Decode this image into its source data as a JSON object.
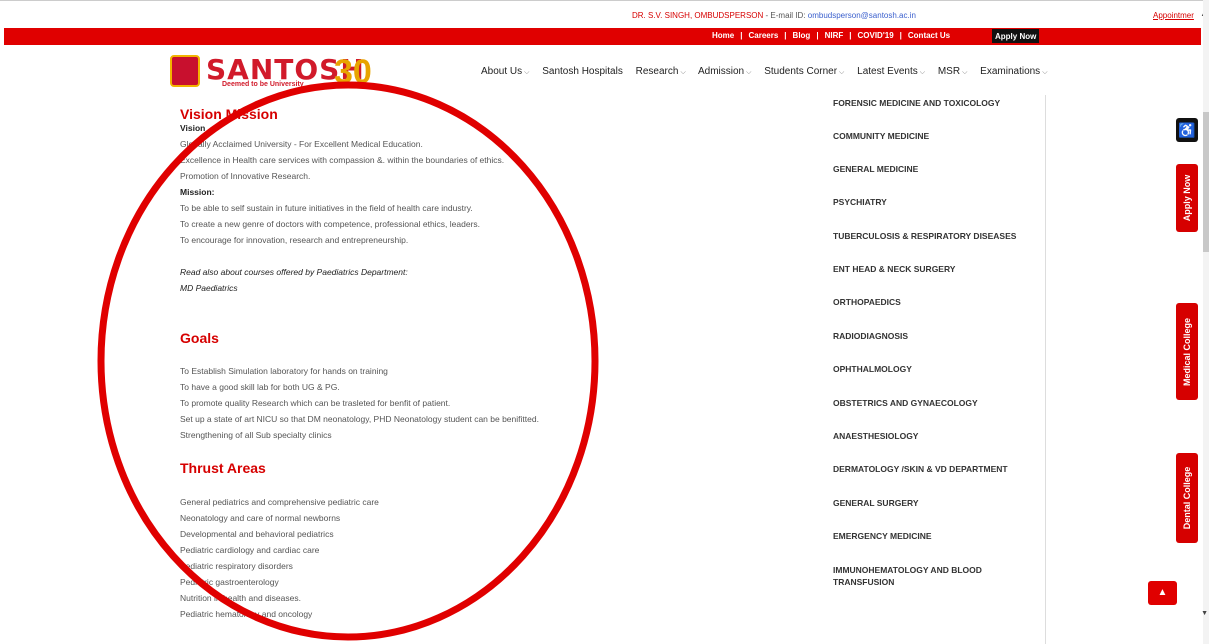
{
  "topbar": {
    "ombud_name": "DR. S.V. SINGH, OMBUDSPERSON",
    "email_label": " - E-mail ID: ",
    "email": "ombudsperson@santosh.ac.in",
    "appointment": "Appointmer",
    "scroll_up": "▲"
  },
  "redbar": {
    "links": [
      "Home",
      "Careers",
      "Blog",
      "NIRF",
      "COVID'19",
      "Contact Us"
    ],
    "apply_now": "Apply Now"
  },
  "header": {
    "logo_text": "SANTOSH",
    "logo_sub": "Deemed to be University",
    "logo_30": "30",
    "nav": [
      "About Us",
      "Santosh Hospitals",
      "Research",
      "Admission",
      "Students Corner",
      "Latest Events",
      "MSR",
      "Examinations"
    ]
  },
  "content": {
    "vision_mission_heading": "Vision Mission",
    "vision_label": "Vision",
    "vision_lines": [
      "Globally Acclaimed University - For Excellent Medical Education.",
      "Excellence in Health care services with compassion &. within the boundaries of ethics.",
      "Promotion of Innovative Research."
    ],
    "mission_label": "Mission:",
    "mission_lines": [
      "To be able to self sustain in future initiatives in the field of health care industry.",
      "To create a new genre of doctors with competence, professional ethics, leaders.",
      "To encourage for innovation, research and entrepreneurship."
    ],
    "read_also": "Read also about courses offered by Paediatrics Department:",
    "md_link": "MD Paediatrics",
    "goals_heading": "Goals",
    "goals_lines": [
      "To Establish Simulation laboratory for hands on training",
      " To have a good skill lab for both UG & PG.",
      "To promote quality Research which can be trasleted for benfit of patient.",
      "Set up a state of art NICU so that DM neonatology, PHD Neonatology student can be benifitted.",
      "Strengthening of  all Sub specialty clinics"
    ],
    "thrust_heading": "Thrust Areas",
    "thrust_lines": [
      "General pediatrics and comprehensive pediatric care",
      "Neonatology and care of normal newborns",
      "Developmental and behavioral pediatrics",
      "Pediatric cardiology and cardiac care",
      "Pediatric respiratory disorders",
      "Pediatric gastroenterology",
      "Nutrition in health and diseases.",
      "Pediatric hematology and oncology"
    ]
  },
  "sidebar": {
    "items": [
      "FORENSIC MEDICINE AND TOXICOLOGY",
      "COMMUNITY MEDICINE",
      "GENERAL MEDICINE",
      "PSYCHIATRY",
      "TUBERCULOSIS & RESPIRATORY DISEASES",
      "ENT HEAD & NECK SURGERY",
      "ORTHOPAEDICS",
      "RADIODIAGNOSIS",
      "OPHTHALMOLOGY",
      "OBSTETRICS AND GYNAECOLOGY",
      "ANAESTHESIOLOGY",
      "DERMATOLOGY /SKIN & VD DEPARTMENT",
      "GENERAL SURGERY",
      "EMERGENCY MEDICINE",
      "IMMUNOHEMATOLOGY AND BLOOD TRANSFUSION"
    ]
  },
  "side_tabs": {
    "accessibility": "♿",
    "apply_now": "Apply Now",
    "medical_college": "Medical College",
    "dental_college": "Dental College",
    "scroll_top": "▲"
  },
  "colors": {
    "brand_red": "#e00000",
    "heading_red": "#d60000",
    "logo_gold": "#e8a400"
  }
}
